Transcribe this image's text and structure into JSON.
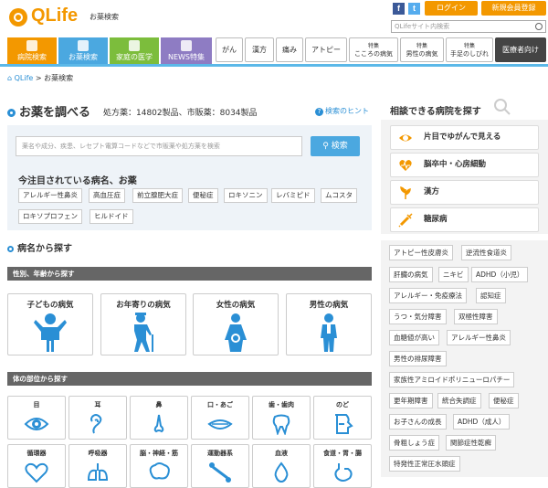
{
  "header": {
    "logo_text": "QLife",
    "logo_sub": "お薬検索",
    "facebook": "f",
    "twitter": "t",
    "login": "ログイン",
    "register": "新規会員登録",
    "search_placeholder": "QLifeサイト内検索"
  },
  "nav": {
    "main_tabs": [
      {
        "label": "病院検索",
        "color": "#f39800"
      },
      {
        "label": "お薬検索",
        "color": "#4ba8e0"
      },
      {
        "label": "家庭の医学",
        "color": "#7cbd3c"
      },
      {
        "label": "NEWS特集",
        "color": "#8e7cc3"
      }
    ],
    "gray_tabs": [
      "がん",
      "漢方",
      "痛み",
      "アトピー"
    ],
    "special_tabs": [
      {
        "small": "特集",
        "label": "こころの病気"
      },
      {
        "small": "特集",
        "label": "男性の病気"
      },
      {
        "small": "特集",
        "label": "手足のしびれ"
      }
    ],
    "medical": "医療者向け"
  },
  "breadcrumb": {
    "home": "QLife",
    "sep": ">",
    "current": "お薬検索"
  },
  "main": {
    "title": "お薬を調べる",
    "counts": "処方薬：14802製品、市販薬：8034製品",
    "hint": "検索のヒント",
    "search_placeholder": "薬名や成分、疾患、レセプト電算コードなどで市販薬や処方薬を検索",
    "search_button": "検索",
    "popular_title": "今注目されている病名、お薬",
    "popular_tags": [
      "アレルギー性鼻炎",
      "高血圧症",
      "前立腺肥大症",
      "便秘症",
      "ロキソニン",
      "レバミピド",
      "ムコスタ",
      "ロキソプロフェン",
      "ヒルドイド"
    ],
    "by_disease": "病名から探す",
    "gender_bar": "性別、年齢から探す",
    "gender_cards": [
      "子どもの病気",
      "お年寄りの病気",
      "女性の病気",
      "男性の病気"
    ],
    "body_bar": "体の部位から探す",
    "body_row1": [
      "目",
      "耳",
      "鼻",
      "口・あご",
      "歯・歯肉",
      "のど"
    ],
    "body_row2": [
      "循環器",
      "呼吸器",
      "脳・神経・筋",
      "運動器系",
      "血液",
      "食道・胃・腸"
    ]
  },
  "right": {
    "title": "相談できる病院を探す",
    "items": [
      "片目でゆがんで見える",
      "脳卒中・心房細動",
      "漢方",
      "糖尿病"
    ],
    "tags": [
      "アトピー性皮膚炎",
      "逆流性食道炎",
      "肝臓の病気",
      "ニキビ",
      "ADHD（小児）",
      "アレルギー・免疫療法",
      "認知症",
      "うつ・気分障害",
      "双極性障害",
      "血糖値が高い",
      "アレルギー性鼻炎",
      "男性の排尿障害",
      "家族性アミロイドポリニューロパチー",
      "更年期障害",
      "統合失調症",
      "便秘症",
      "お子さんの成長",
      "ADHD（成人）",
      "骨粗しょう症",
      "関節症性乾癬",
      "特発性正常圧水頭症"
    ]
  },
  "colors": {
    "accent": "#f39800",
    "blue": "#4ba8e0",
    "link": "#2a8fd5"
  }
}
